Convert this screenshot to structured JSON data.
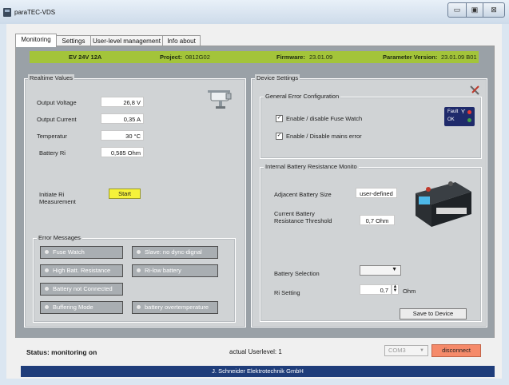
{
  "window": {
    "title": "paraTEC-VDS",
    "buttons": {
      "minimize": "▭",
      "maximize": "▣",
      "close": "⊠"
    }
  },
  "tabs": [
    "Monitoring",
    "Settings",
    "User-level management",
    "Info about"
  ],
  "infobar": {
    "device": "EV 24V 12A",
    "project_label": "Project:",
    "project_value": "0812G02",
    "firmware_label": "Firmware:",
    "firmware_value": "23.01.09",
    "param_label": "Parameter Version:",
    "param_value": "23.01.09 B01"
  },
  "realtime": {
    "title": "Realtime Values",
    "rows": [
      {
        "label": "Output Voltage",
        "value": "26,8 V"
      },
      {
        "label": "Output Current",
        "value": "0,35 A"
      },
      {
        "label": "Temperatur",
        "value": "30 °C"
      },
      {
        "label": "Battery Ri",
        "value": "0,585 Ohm"
      }
    ],
    "initiate_label_1": "Initiate Ri",
    "initiate_label_2": "Measurement",
    "start_button": "Start"
  },
  "errors": {
    "title": "Error Messages",
    "left": [
      "Fuse Watch",
      "High Batt. Resistance",
      "Battery not Connected",
      "Buffering Mode"
    ],
    "right": [
      "Slave: no dync-dignal",
      "Ri-low battery",
      "battery overtemperature"
    ]
  },
  "device_settings": {
    "title": "Device Settings",
    "general": {
      "title": "General Error Configuration",
      "check1": "Enable / disable Fuse Watch",
      "check2": "Enable / Disable mains error",
      "fault_label": "Fault",
      "ok_label": "OK",
      "fault_color": "#e53935",
      "ok_color": "#43a047"
    },
    "internal": {
      "title": "Internal Battery Resistance Monito",
      "adjacent_label": "Adjacent Battery Size",
      "adjacent_value": "user-defined",
      "threshold_label_1": "Current Battery",
      "threshold_label_2": "Resistance Threshold",
      "threshold_value": "0,7 Ohm",
      "battery_selection_label": "Battery Selection",
      "battery_selection_value": "",
      "ri_label": "Ri Setting",
      "ri_value": "0,7",
      "ri_unit": "Ohm",
      "save_button": "Save to Device"
    }
  },
  "status": {
    "text": "Status: monitoring on",
    "userlevel": "actual Userlevel:  1",
    "com_port": "COM3",
    "disconnect": "disconnect"
  },
  "footer": "J. Schneider Elektrotechnik GmbH",
  "colors": {
    "infobar": "#a3c43a",
    "start": "#f5f23a",
    "disconnect": "#f58a6a",
    "footer": "#1f3d7a"
  }
}
